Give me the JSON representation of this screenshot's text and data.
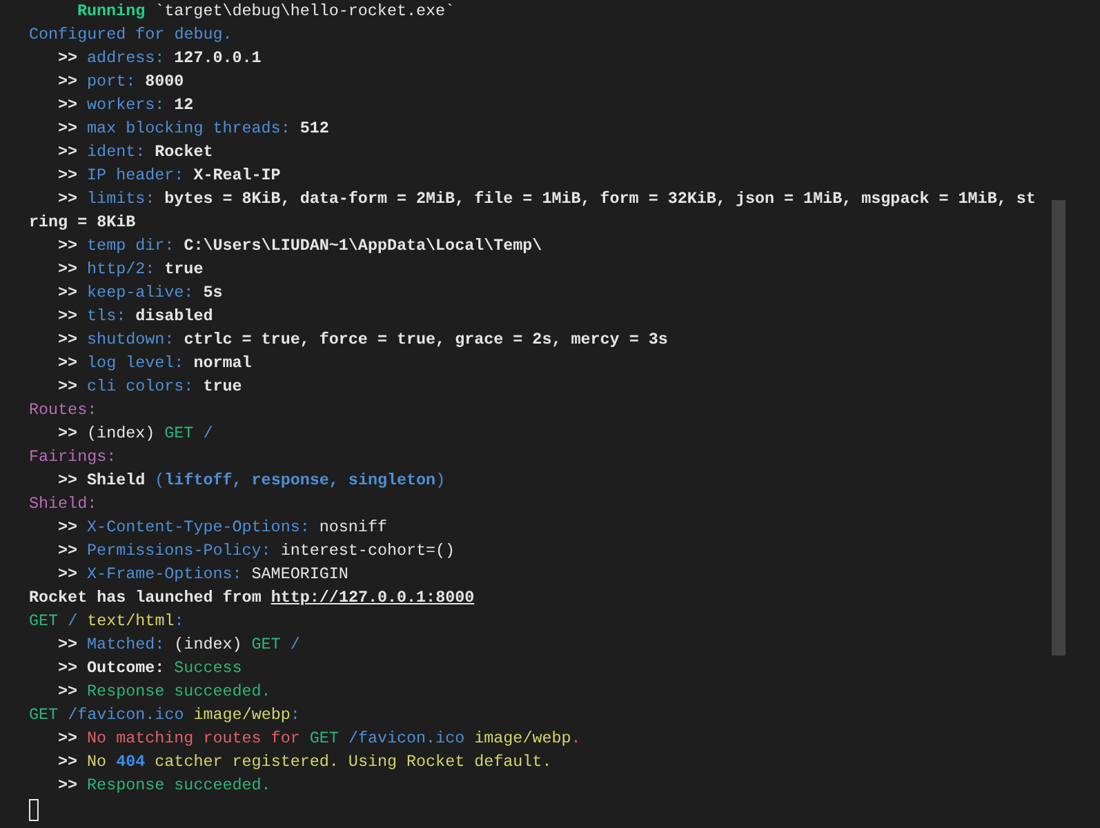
{
  "terminal": {
    "lines": [
      {
        "kind": "status",
        "segments": [
          {
            "text": "Running",
            "color": "#23d18b",
            "bold": true
          },
          {
            "text": " `target\\debug\\hello-rocket.exe`",
            "color": "#e5e5e5",
            "bold": false
          }
        ]
      },
      {
        "kind": "header",
        "segments": [
          {
            "text": "Configured for debug.",
            "color": "#4f8fd6",
            "bold": false
          }
        ]
      },
      {
        "kind": "item",
        "segments": [
          {
            "text": ">> ",
            "color": "#e5e5e5",
            "bold": true
          },
          {
            "text": "address: ",
            "color": "#4f8fd6",
            "bold": false
          },
          {
            "text": "127.0.0.1",
            "color": "#e5e5e5",
            "bold": true
          }
        ]
      },
      {
        "kind": "item",
        "segments": [
          {
            "text": ">> ",
            "color": "#e5e5e5",
            "bold": true
          },
          {
            "text": "port: ",
            "color": "#4f8fd6",
            "bold": false
          },
          {
            "text": "8000",
            "color": "#e5e5e5",
            "bold": true
          }
        ]
      },
      {
        "kind": "item",
        "segments": [
          {
            "text": ">> ",
            "color": "#e5e5e5",
            "bold": true
          },
          {
            "text": "workers: ",
            "color": "#4f8fd6",
            "bold": false
          },
          {
            "text": "12",
            "color": "#e5e5e5",
            "bold": true
          }
        ]
      },
      {
        "kind": "item",
        "segments": [
          {
            "text": ">> ",
            "color": "#e5e5e5",
            "bold": true
          },
          {
            "text": "max blocking threads: ",
            "color": "#4f8fd6",
            "bold": false
          },
          {
            "text": "512",
            "color": "#e5e5e5",
            "bold": true
          }
        ]
      },
      {
        "kind": "item",
        "segments": [
          {
            "text": ">> ",
            "color": "#e5e5e5",
            "bold": true
          },
          {
            "text": "ident: ",
            "color": "#4f8fd6",
            "bold": false
          },
          {
            "text": "Rocket",
            "color": "#e5e5e5",
            "bold": true
          }
        ]
      },
      {
        "kind": "item",
        "segments": [
          {
            "text": ">> ",
            "color": "#e5e5e5",
            "bold": true
          },
          {
            "text": "IP header: ",
            "color": "#4f8fd6",
            "bold": false
          },
          {
            "text": "X-Real-IP",
            "color": "#e5e5e5",
            "bold": true
          }
        ]
      },
      {
        "kind": "item",
        "segments": [
          {
            "text": ">> ",
            "color": "#e5e5e5",
            "bold": true
          },
          {
            "text": "limits: ",
            "color": "#4f8fd6",
            "bold": false
          },
          {
            "text": "bytes = 8KiB, data-form = 2MiB, file = 1MiB, form = 32KiB, json = 1MiB, msgpack = 1MiB, st",
            "color": "#e5e5e5",
            "bold": true
          }
        ]
      },
      {
        "kind": "header",
        "segments": [
          {
            "text": "ring = 8KiB",
            "color": "#e5e5e5",
            "bold": true
          }
        ]
      },
      {
        "kind": "item",
        "segments": [
          {
            "text": ">> ",
            "color": "#e5e5e5",
            "bold": true
          },
          {
            "text": "temp dir: ",
            "color": "#4f8fd6",
            "bold": false
          },
          {
            "text": "C:\\Users\\LIUDAN~1\\AppData\\Local\\Temp\\",
            "color": "#e5e5e5",
            "bold": true
          }
        ]
      },
      {
        "kind": "item",
        "segments": [
          {
            "text": ">> ",
            "color": "#e5e5e5",
            "bold": true
          },
          {
            "text": "http/2: ",
            "color": "#4f8fd6",
            "bold": false
          },
          {
            "text": "true",
            "color": "#e5e5e5",
            "bold": true
          }
        ]
      },
      {
        "kind": "item",
        "segments": [
          {
            "text": ">> ",
            "color": "#e5e5e5",
            "bold": true
          },
          {
            "text": "keep-alive: ",
            "color": "#4f8fd6",
            "bold": false
          },
          {
            "text": "5s",
            "color": "#e5e5e5",
            "bold": true
          }
        ]
      },
      {
        "kind": "item",
        "segments": [
          {
            "text": ">> ",
            "color": "#e5e5e5",
            "bold": true
          },
          {
            "text": "tls: ",
            "color": "#4f8fd6",
            "bold": false
          },
          {
            "text": "disabled",
            "color": "#e5e5e5",
            "bold": true
          }
        ]
      },
      {
        "kind": "item",
        "segments": [
          {
            "text": ">> ",
            "color": "#e5e5e5",
            "bold": true
          },
          {
            "text": "shutdown: ",
            "color": "#4f8fd6",
            "bold": false
          },
          {
            "text": "ctrlc = true, force = true, grace = 2s, mercy = 3s",
            "color": "#e5e5e5",
            "bold": true
          }
        ]
      },
      {
        "kind": "item",
        "segments": [
          {
            "text": ">> ",
            "color": "#e5e5e5",
            "bold": true
          },
          {
            "text": "log level: ",
            "color": "#4f8fd6",
            "bold": false
          },
          {
            "text": "normal",
            "color": "#e5e5e5",
            "bold": true
          }
        ]
      },
      {
        "kind": "item",
        "segments": [
          {
            "text": ">> ",
            "color": "#e5e5e5",
            "bold": true
          },
          {
            "text": "cli colors: ",
            "color": "#4f8fd6",
            "bold": false
          },
          {
            "text": "true",
            "color": "#e5e5e5",
            "bold": true
          }
        ]
      },
      {
        "kind": "header",
        "segments": [
          {
            "text": "Routes:",
            "color": "#b86cb8",
            "bold": false
          }
        ]
      },
      {
        "kind": "item",
        "segments": [
          {
            "text": ">> ",
            "color": "#e5e5e5",
            "bold": true
          },
          {
            "text": "(index) ",
            "color": "#e5e5e5",
            "bold": false
          },
          {
            "text": "GET ",
            "color": "#2fb37d",
            "bold": false
          },
          {
            "text": "/",
            "color": "#4f8fd6",
            "bold": false
          }
        ]
      },
      {
        "kind": "header",
        "segments": [
          {
            "text": "Fairings:",
            "color": "#b86cb8",
            "bold": false
          }
        ]
      },
      {
        "kind": "item",
        "segments": [
          {
            "text": ">> ",
            "color": "#e5e5e5",
            "bold": true
          },
          {
            "text": "Shield ",
            "color": "#e5e5e5",
            "bold": true
          },
          {
            "text": "(",
            "color": "#4f8fd6",
            "bold": false
          },
          {
            "text": "liftoff, response, singleton",
            "color": "#4f8fd6",
            "bold": true
          },
          {
            "text": ")",
            "color": "#4f8fd6",
            "bold": false
          }
        ]
      },
      {
        "kind": "header",
        "segments": [
          {
            "text": "Shield:",
            "color": "#b86cb8",
            "bold": false
          }
        ]
      },
      {
        "kind": "item",
        "segments": [
          {
            "text": ">> ",
            "color": "#e5e5e5",
            "bold": true
          },
          {
            "text": "X-Content-Type-Options: ",
            "color": "#4f8fd6",
            "bold": false
          },
          {
            "text": "nosniff",
            "color": "#e5e5e5",
            "bold": false
          }
        ]
      },
      {
        "kind": "item",
        "segments": [
          {
            "text": ">> ",
            "color": "#e5e5e5",
            "bold": true
          },
          {
            "text": "Permissions-Policy: ",
            "color": "#4f8fd6",
            "bold": false
          },
          {
            "text": "interest-cohort=()",
            "color": "#e5e5e5",
            "bold": false
          }
        ]
      },
      {
        "kind": "item",
        "segments": [
          {
            "text": ">> ",
            "color": "#e5e5e5",
            "bold": true
          },
          {
            "text": "X-Frame-Options: ",
            "color": "#4f8fd6",
            "bold": false
          },
          {
            "text": "SAMEORIGIN",
            "color": "#e5e5e5",
            "bold": false
          }
        ]
      },
      {
        "kind": "header",
        "segments": [
          {
            "text": "Rocket has launched from ",
            "color": "#e5e5e5",
            "bold": true
          },
          {
            "text": "http://127.0.0.1:8000",
            "color": "#e5e5e5",
            "bold": true,
            "underline": true
          }
        ]
      },
      {
        "kind": "header",
        "segments": [
          {
            "text": "GET ",
            "color": "#2fb37d",
            "bold": false
          },
          {
            "text": "/ ",
            "color": "#4f8fd6",
            "bold": false
          },
          {
            "text": "text/html",
            "color": "#d4d46a",
            "bold": false
          },
          {
            "text": ":",
            "color": "#4f8fd6",
            "bold": false
          }
        ]
      },
      {
        "kind": "item",
        "segments": [
          {
            "text": ">> ",
            "color": "#e5e5e5",
            "bold": true
          },
          {
            "text": "Matched: ",
            "color": "#4f8fd6",
            "bold": false
          },
          {
            "text": "(index) ",
            "color": "#e5e5e5",
            "bold": false
          },
          {
            "text": "GET ",
            "color": "#2fb37d",
            "bold": false
          },
          {
            "text": "/",
            "color": "#4f8fd6",
            "bold": false
          }
        ]
      },
      {
        "kind": "item",
        "segments": [
          {
            "text": ">> ",
            "color": "#e5e5e5",
            "bold": true
          },
          {
            "text": "Outcome: ",
            "color": "#e5e5e5",
            "bold": true
          },
          {
            "text": "Success",
            "color": "#2fb37d",
            "bold": false
          }
        ]
      },
      {
        "kind": "item",
        "segments": [
          {
            "text": ">> ",
            "color": "#e5e5e5",
            "bold": true
          },
          {
            "text": "Response succeeded.",
            "color": "#2fb37d",
            "bold": false
          }
        ]
      },
      {
        "kind": "header",
        "segments": [
          {
            "text": "GET ",
            "color": "#2fb37d",
            "bold": false
          },
          {
            "text": "/favicon.ico ",
            "color": "#4f8fd6",
            "bold": false
          },
          {
            "text": "image/webp",
            "color": "#d4d46a",
            "bold": false
          },
          {
            "text": ":",
            "color": "#4f8fd6",
            "bold": false
          }
        ]
      },
      {
        "kind": "item",
        "segments": [
          {
            "text": ">> ",
            "color": "#e5e5e5",
            "bold": true
          },
          {
            "text": "No matching routes for ",
            "color": "#e0606a",
            "bold": false
          },
          {
            "text": "GET ",
            "color": "#2fb37d",
            "bold": false
          },
          {
            "text": "/favicon.ico ",
            "color": "#4f8fd6",
            "bold": false
          },
          {
            "text": "image/webp",
            "color": "#d4d46a",
            "bold": false
          },
          {
            "text": ".",
            "color": "#e0606a",
            "bold": false
          }
        ]
      },
      {
        "kind": "item",
        "segments": [
          {
            "text": ">> ",
            "color": "#e5e5e5",
            "bold": true
          },
          {
            "text": "No ",
            "color": "#d4d46a",
            "bold": false
          },
          {
            "text": "404",
            "color": "#3b8eea",
            "bold": true
          },
          {
            "text": " catcher registered. Using Rocket default.",
            "color": "#d4d46a",
            "bold": false
          }
        ]
      },
      {
        "kind": "item",
        "segments": [
          {
            "text": ">> ",
            "color": "#e5e5e5",
            "bold": true
          },
          {
            "text": "Response succeeded.",
            "color": "#2fb37d",
            "bold": false
          }
        ]
      }
    ]
  }
}
